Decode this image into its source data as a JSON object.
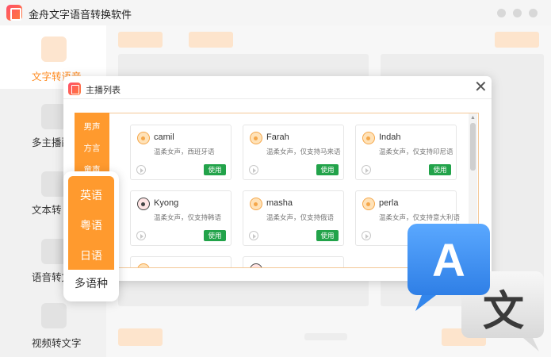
{
  "app": {
    "title": "金舟文字语音转换软件"
  },
  "sidebar": {
    "items": [
      {
        "label": "文字转语音",
        "active": true
      },
      {
        "label": "多主播配",
        "active": false
      },
      {
        "label": "文本转",
        "active": false
      },
      {
        "label": "语音转文",
        "active": false
      },
      {
        "label": "视频转文字",
        "active": false
      }
    ]
  },
  "dialog": {
    "title": "主播列表",
    "close_icon": "close-icon",
    "categories": [
      "男声",
      "方言",
      "童声"
    ],
    "use_label": "使用",
    "cards": [
      {
        "name": "camil",
        "desc": "温柔女声，西班牙语",
        "gender": "female"
      },
      {
        "name": "Farah",
        "desc": "温柔女声，仅支持马来语",
        "gender": "female"
      },
      {
        "name": "Indah",
        "desc": "温柔女声，仅支持印尼语",
        "gender": "female"
      },
      {
        "name": "Kyong",
        "desc": "温柔女声，仅支持韩语",
        "gender": "male"
      },
      {
        "name": "masha",
        "desc": "温柔女声，仅支持俄语",
        "gender": "female"
      },
      {
        "name": "perla",
        "desc": "温柔女声，仅支持意大利语",
        "gender": "female"
      }
    ]
  },
  "language_panel": {
    "items": [
      "英语",
      "粤语",
      "日语",
      "多语种"
    ]
  },
  "translate_icon": {
    "letter_a": "A",
    "letter_wen": "文"
  },
  "colors": {
    "accent": "#ff9a2e",
    "use_button": "#22a34a",
    "blue_bubble": "#3d8ff0",
    "gray_bubble": "#e9e9e9"
  }
}
